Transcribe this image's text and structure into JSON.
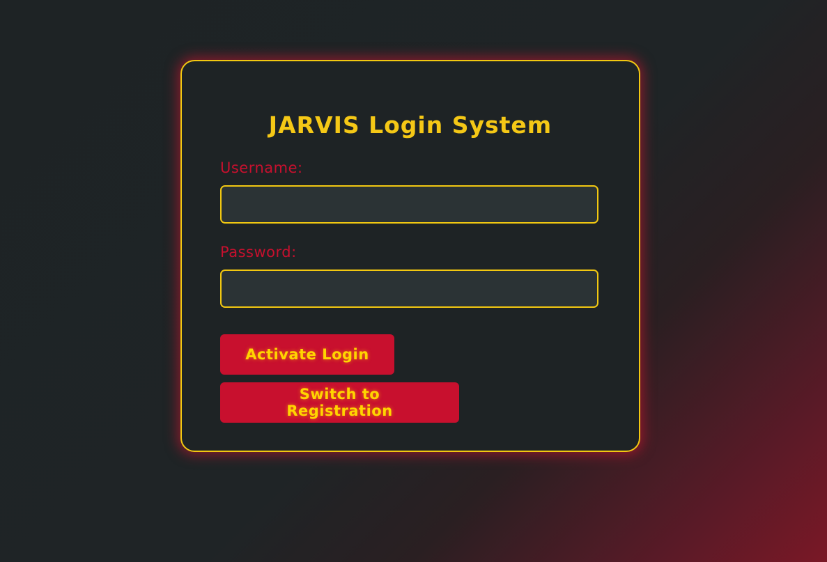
{
  "login": {
    "title": "JARVIS Login System",
    "username_label": "Username:",
    "username_value": "",
    "password_label": "Password:",
    "password_value": "",
    "login_button": "Activate Login",
    "switch_button": "Switch to Registration"
  },
  "colors": {
    "accent_yellow": "#f2c811",
    "accent_red": "#c8102e",
    "background": "#1e2325",
    "input_background": "#2b3335"
  }
}
